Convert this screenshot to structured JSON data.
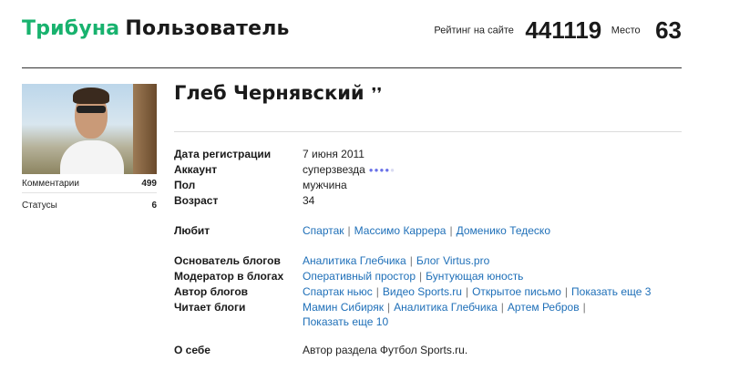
{
  "header": {
    "brand": "Трибуна",
    "section": "Пользователь",
    "rating_label": "Рейтинг на сайте",
    "rating_value": "441119",
    "place_label": "Место",
    "place_value": "63"
  },
  "sidebar": {
    "stats": [
      {
        "label": "Комментарии",
        "value": "499"
      },
      {
        "label": "Статусы",
        "value": "6"
      }
    ]
  },
  "profile": {
    "name": "Глеб Чернявский",
    "name_mark": "❜❜",
    "fields": {
      "registration": {
        "label": "Дата регистрации",
        "value": "7 июня 2011"
      },
      "account": {
        "label": "Аккаунт",
        "value": "суперзвезда",
        "level_dots_on": 4,
        "level_dots_total": 5
      },
      "gender": {
        "label": "Пол",
        "value": "мужчина"
      },
      "age": {
        "label": "Возраст",
        "value": "34"
      }
    },
    "likes": {
      "label": "Любит",
      "items": [
        "Спартак",
        "Массимо Каррера",
        "Доменико Тедеско"
      ]
    },
    "blogs": {
      "founder": {
        "label": "Основатель блогов",
        "items": [
          "Аналитика Глебчика",
          "Блог Virtus.pro"
        ]
      },
      "moderator": {
        "label": "Модератор в блогах",
        "items": [
          "Оперативный простор",
          "Бунтующая юность"
        ]
      },
      "author": {
        "label": "Автор блогов",
        "items": [
          "Спартак ньюс",
          "Видео Sports.ru",
          "Открытое письмо",
          "Показать еще 3"
        ]
      },
      "reads": {
        "label": "Читает блоги",
        "items": [
          "Мамин Сибиряк",
          "Аналитика Глебчика",
          "Артем Ребров"
        ],
        "more": "Показать еще 10"
      }
    },
    "about": {
      "label": "О себе",
      "value": "Автор раздела Футбол Sports.ru."
    }
  },
  "colors": {
    "brand_green": "#18b26e",
    "link": "#1e6fb8",
    "dot_on": "#6a72e8",
    "dot_off": "#d9dbf2"
  }
}
